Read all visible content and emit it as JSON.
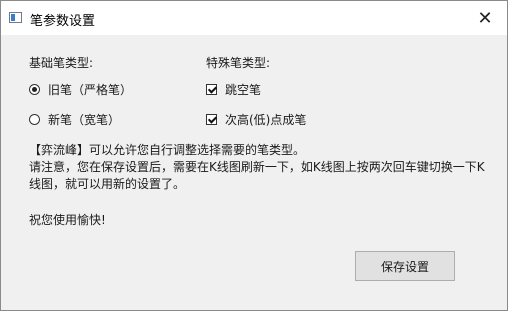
{
  "window": {
    "title": "笔参数设置",
    "close_glyph": "✕"
  },
  "basic_group": {
    "title": "基础笔类型:",
    "options": [
      {
        "label": "旧笔（严格笔）",
        "selected": true
      },
      {
        "label": "新笔（宽笔）",
        "selected": false
      }
    ]
  },
  "special_group": {
    "title": "特殊笔类型:",
    "options": [
      {
        "label": "跳空笔",
        "checked": true
      },
      {
        "label": "次高(低)点成笔",
        "checked": true
      }
    ]
  },
  "notes": {
    "line1": "【弈流峰】可以允许您自行调整选择需要的笔类型。",
    "line2": "请注意，您在保存设置后，需要在K线图刷新一下，如K线图上按两次回车键切换一下K",
    "line3": "线图，就可以用新的设置了。",
    "thanks": "祝您使用愉快!"
  },
  "buttons": {
    "save": "保存设置"
  }
}
